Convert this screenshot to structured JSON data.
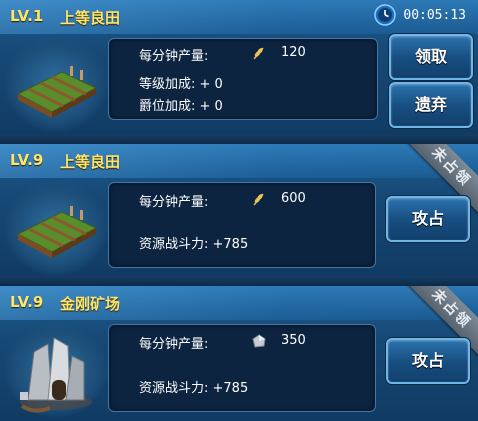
{
  "timer": "00:05:13",
  "cards": [
    {
      "level": "LV.1",
      "name": "上等良田",
      "yield_label": "每分钟产量:",
      "yield_value": "120",
      "resource_icon": "wheat-icon",
      "stat1": "等级加成: + 0",
      "stat2": "爵位加成: + 0",
      "buttons": [
        "领取",
        "遗弃"
      ]
    },
    {
      "level": "LV.9",
      "name": "上等良田",
      "yield_label": "每分钟产量:",
      "yield_value": "600",
      "resource_icon": "wheat-icon",
      "power": "资源战斗力: +785",
      "ribbon": "未占领",
      "button": "攻占"
    },
    {
      "level": "LV.9",
      "name": "金刚矿场",
      "yield_label": "每分钟产量:",
      "yield_value": "350",
      "resource_icon": "ore-icon",
      "power": "资源战斗力: +785",
      "ribbon": "未占领",
      "button": "攻占"
    }
  ]
}
